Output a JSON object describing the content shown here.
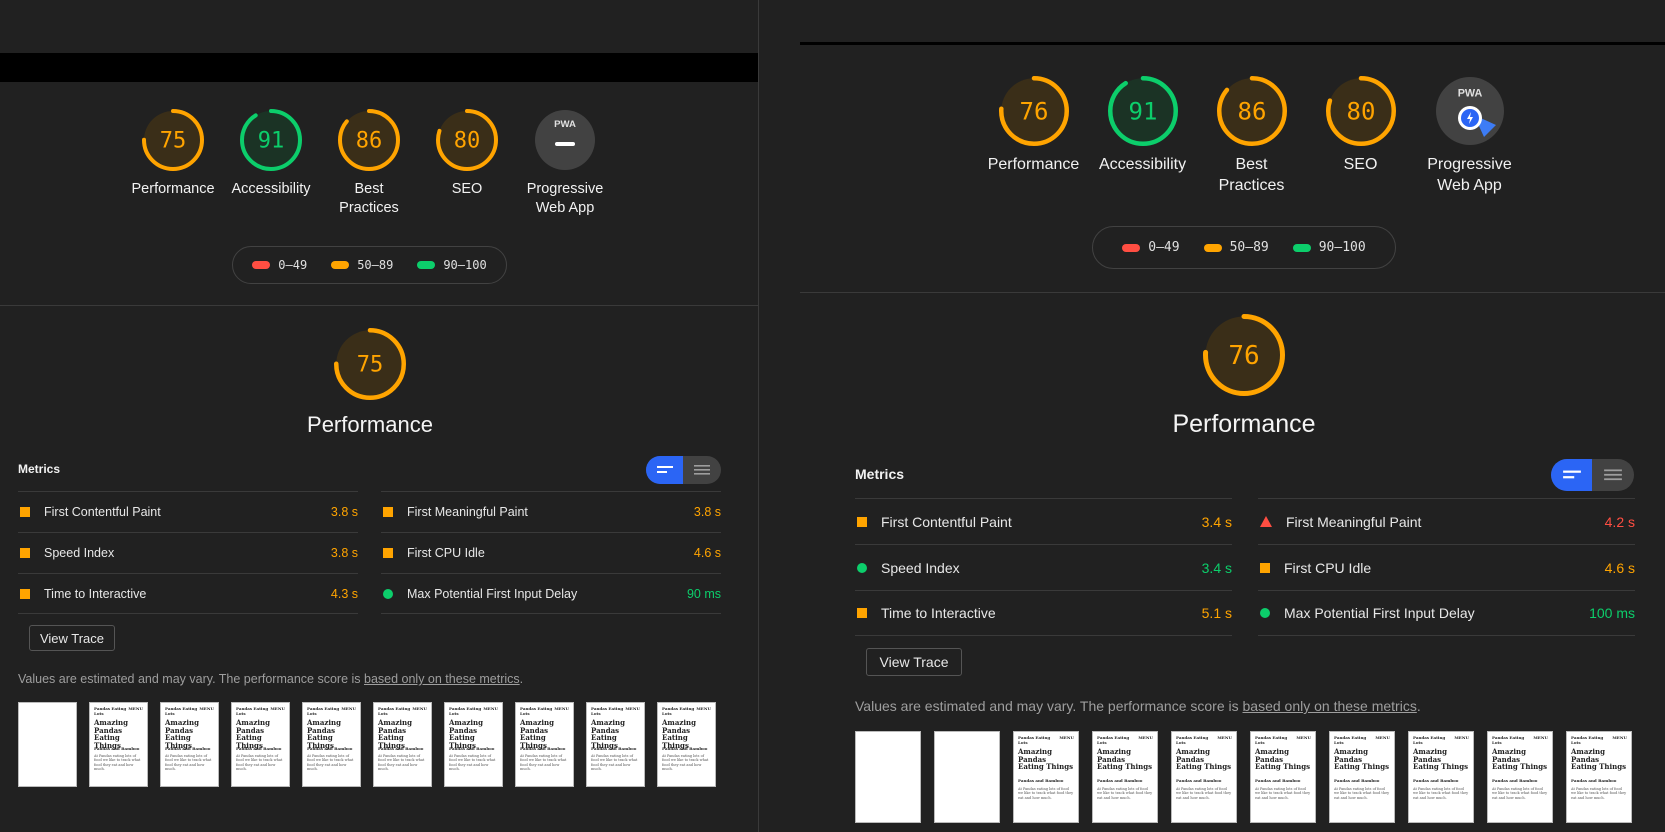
{
  "left": {
    "categories": [
      {
        "label": "Performance",
        "score": "75",
        "fraction": 0.75,
        "color": "#ffa400",
        "bg": "#3a2e18"
      },
      {
        "label": "Accessibility",
        "score": "91",
        "fraction": 0.91,
        "color": "#0cce6b",
        "bg": "#1b3325"
      },
      {
        "label": "Best Practices",
        "score": "86",
        "fraction": 0.86,
        "color": "#ffa400",
        "bg": "#3a2e18"
      },
      {
        "label": "SEO",
        "score": "80",
        "fraction": 0.8,
        "color": "#ffa400",
        "bg": "#3a2e18"
      },
      {
        "label": "Progressive Web App",
        "score": "",
        "pwa": true,
        "badge": "PWA"
      }
    ],
    "performance": {
      "score": "75",
      "fraction": 0.75,
      "title": "Performance"
    },
    "metrics_title": "Metrics",
    "metrics_left": [
      {
        "name": "First Contentful Paint",
        "value": "3.8 s",
        "status": "average"
      },
      {
        "name": "Speed Index",
        "value": "3.8 s",
        "status": "average"
      },
      {
        "name": "Time to Interactive",
        "value": "4.3 s",
        "status": "average"
      }
    ],
    "metrics_right": [
      {
        "name": "First Meaningful Paint",
        "value": "3.8 s",
        "status": "average"
      },
      {
        "name": "First CPU Idle",
        "value": "4.6 s",
        "status": "average"
      },
      {
        "name": "Max Potential First Input Delay",
        "value": "90 ms",
        "status": "pass"
      }
    ],
    "view_trace": "View Trace",
    "estimate_text": "Values are estimated and may vary. The performance score is ",
    "estimate_link": "based only on these metrics",
    "estimate_end": ".",
    "frames": [
      {
        "blank": true
      },
      {
        "blank": false
      },
      {
        "blank": false
      },
      {
        "blank": false
      },
      {
        "blank": false
      },
      {
        "blank": false
      },
      {
        "blank": false
      },
      {
        "blank": false
      },
      {
        "blank": false
      },
      {
        "blank": false
      }
    ]
  },
  "right": {
    "categories": [
      {
        "label": "Performance",
        "score": "76",
        "fraction": 0.76,
        "color": "#ffa400",
        "bg": "#3a2e18"
      },
      {
        "label": "Accessibility",
        "score": "91",
        "fraction": 0.91,
        "color": "#0cce6b",
        "bg": "#1b3325"
      },
      {
        "label": "Best Practices",
        "score": "86",
        "fraction": 0.86,
        "color": "#ffa400",
        "bg": "#3a2e18"
      },
      {
        "label": "SEO",
        "score": "80",
        "fraction": 0.8,
        "color": "#ffa400",
        "bg": "#3a2e18"
      },
      {
        "label": "Progressive Web App",
        "score": "",
        "pwa": true,
        "badge": "PWA"
      }
    ],
    "performance": {
      "score": "76",
      "fraction": 0.76,
      "title": "Performance"
    },
    "metrics_title": "Metrics",
    "metrics_left": [
      {
        "name": "First Contentful Paint",
        "value": "3.4 s",
        "status": "average"
      },
      {
        "name": "Speed Index",
        "value": "3.4 s",
        "status": "pass"
      },
      {
        "name": "Time to Interactive",
        "value": "5.1 s",
        "status": "average"
      }
    ],
    "metrics_right": [
      {
        "name": "First Meaningful Paint",
        "value": "4.2 s",
        "status": "fail"
      },
      {
        "name": "First CPU Idle",
        "value": "4.6 s",
        "status": "average"
      },
      {
        "name": "Max Potential First Input Delay",
        "value": "100 ms",
        "status": "pass"
      }
    ],
    "view_trace": "View Trace",
    "estimate_text": "Values are estimated and may vary. The performance score is ",
    "estimate_link": "based only on these metrics",
    "estimate_end": ".",
    "frames": [
      {
        "blank": true
      },
      {
        "blank": true
      },
      {
        "blank": false
      },
      {
        "blank": false
      },
      {
        "blank": false
      },
      {
        "blank": false
      },
      {
        "blank": false
      },
      {
        "blank": false
      },
      {
        "blank": false
      },
      {
        "blank": false
      }
    ]
  },
  "legend": [
    {
      "label": "0–49",
      "color": "#ff4e42"
    },
    {
      "label": "50–89",
      "color": "#ffa400"
    },
    {
      "label": "90–100",
      "color": "#0cce6b"
    }
  ],
  "frame_text": {
    "site": "Pandas Eating Lots",
    "menu": "MENU",
    "headline": "Amazing Pandas Eating Things",
    "section": "Pandas and Bamboo",
    "body": "At Pandas eating lots of food we like to track what food they eat and how much."
  }
}
